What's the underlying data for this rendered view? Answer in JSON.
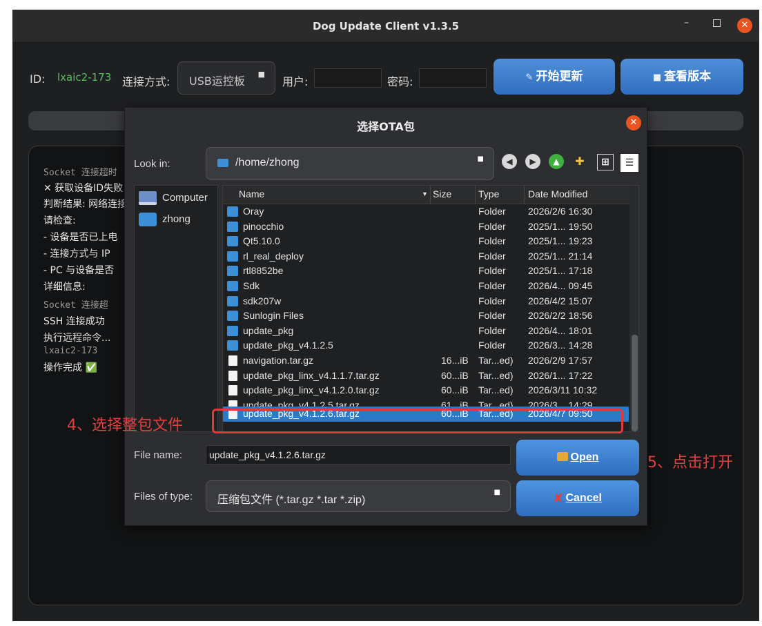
{
  "window": {
    "title": "Dog Update Client v1.3.5"
  },
  "toolbar": {
    "id_label": "ID:",
    "id_value": "lxaic2-173",
    "connection_label": "连接方式:",
    "connection_value": "USB运控板",
    "user_label": "用户:",
    "user_value": "",
    "password_label": "密码:",
    "password_value": "",
    "start_update_label": "开始更新",
    "view_version_label": "查看版本"
  },
  "log": {
    "lines": [
      "Socket 连接超时",
      "✕ 获取设备ID失败",
      "判断结果: 网络连接",
      "请检查:",
      "- 设备是否已上电",
      "- 连接方式与 IP",
      "- PC 与设备是否",
      "详细信息:",
      "  Socket 连接超",
      "SSH 连接成功",
      "执行远程命令...",
      "lxaic2-173",
      "操作完成 ✅"
    ]
  },
  "dialog": {
    "title": "选择OTA包",
    "look_in_label": "Look in:",
    "path": "/home/zhong",
    "sidebar": [
      "Computer",
      "zhong"
    ],
    "columns": [
      "Name",
      "Size",
      "Type",
      "Date Modified"
    ],
    "files": [
      {
        "name": "Oray",
        "size": "",
        "type": "Folder",
        "date": "2026/2/6 16:30",
        "kind": "folder"
      },
      {
        "name": "pinocchio",
        "size": "",
        "type": "Folder",
        "date": "2025/1... 19:50",
        "kind": "folder"
      },
      {
        "name": "Qt5.10.0",
        "size": "",
        "type": "Folder",
        "date": "2025/1... 19:23",
        "kind": "folder"
      },
      {
        "name": "rl_real_deploy",
        "size": "",
        "type": "Folder",
        "date": "2025/1... 21:14",
        "kind": "folder"
      },
      {
        "name": "rtl8852be",
        "size": "",
        "type": "Folder",
        "date": "2025/1... 17:18",
        "kind": "folder"
      },
      {
        "name": "Sdk",
        "size": "",
        "type": "Folder",
        "date": "2026/4... 09:45",
        "kind": "folder"
      },
      {
        "name": "sdk207w",
        "size": "",
        "type": "Folder",
        "date": "2026/4/2 15:07",
        "kind": "folder"
      },
      {
        "name": "Sunlogin Files",
        "size": "",
        "type": "Folder",
        "date": "2026/2/2 18:56",
        "kind": "folder"
      },
      {
        "name": "update_pkg",
        "size": "",
        "type": "Folder",
        "date": "2026/4... 18:01",
        "kind": "folder"
      },
      {
        "name": "update_pkg_v4.1.2.5",
        "size": "",
        "type": "Folder",
        "date": "2026/3... 14:28",
        "kind": "folder"
      },
      {
        "name": "navigation.tar.gz",
        "size": "16...iB",
        "type": "Tar...ed)",
        "date": "2026/2/9 17:57",
        "kind": "file"
      },
      {
        "name": "update_pkg_linx_v4.1.1.7.tar.gz",
        "size": "60...iB",
        "type": "Tar...ed)",
        "date": "2026/1... 17:22",
        "kind": "file"
      },
      {
        "name": "update_pkg_linx_v4.1.2.0.tar.gz",
        "size": "60...iB",
        "type": "Tar...ed)",
        "date": "2026/3/11 10:32",
        "kind": "file"
      },
      {
        "name": "update_pkg_v4.1.2.5.tar.gz",
        "size": "61...iB",
        "type": "Tar...ed)",
        "date": "2026/3... 14:29",
        "kind": "file"
      },
      {
        "name": "update_pkg_v4.1.2.6.tar.gz",
        "size": "60...iB",
        "type": "Tar...ed)",
        "date": "2026/4/7 09:50",
        "kind": "file",
        "selected": true
      }
    ],
    "file_name_label": "File name:",
    "file_name_value": "update_pkg_v4.1.2.6.tar.gz",
    "file_type_label": "Files of type:",
    "file_type_value": "压缩包文件 (*.tar.gz *.tar *.zip)",
    "open_label": "Open",
    "cancel_label": "Cancel"
  },
  "annotations": {
    "step4": "4、选择整包文件",
    "step5": "5、点击打开"
  },
  "colors": {
    "accent_button": "#3a7fd0",
    "selection": "#2b7ac8",
    "annotation": "#e03a3a",
    "id_text": "#58c060"
  }
}
